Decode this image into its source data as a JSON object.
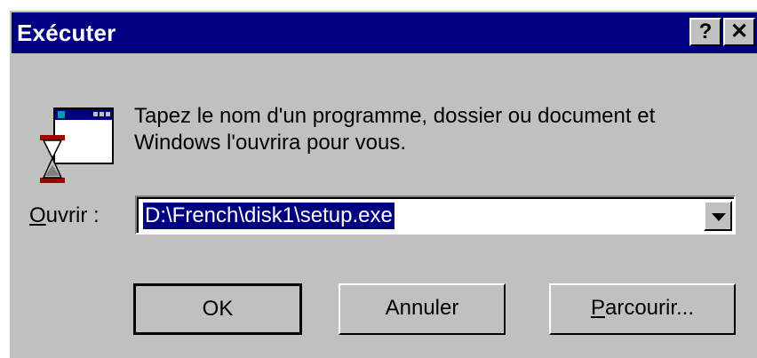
{
  "window": {
    "title": "Exécuter"
  },
  "titlebar": {
    "help_label": "?",
    "close_label": "✕"
  },
  "description": {
    "line1": "Tapez le nom d'un programme, dossier ou document et",
    "line2": "Windows l'ouvrira pour vous."
  },
  "open": {
    "label_accel": "O",
    "label_rest": "uvrir :",
    "value": "D:\\French\\disk1\\setup.exe"
  },
  "buttons": {
    "ok": "OK",
    "cancel": "Annuler",
    "browse_accel": "P",
    "browse_rest": "arcourir..."
  },
  "icons": {
    "app": "run-program-icon",
    "dropdown": "chevron-down-icon"
  },
  "colors": {
    "titlebar": "#000080",
    "face": "#c0c0c0",
    "selection": "#000080"
  }
}
